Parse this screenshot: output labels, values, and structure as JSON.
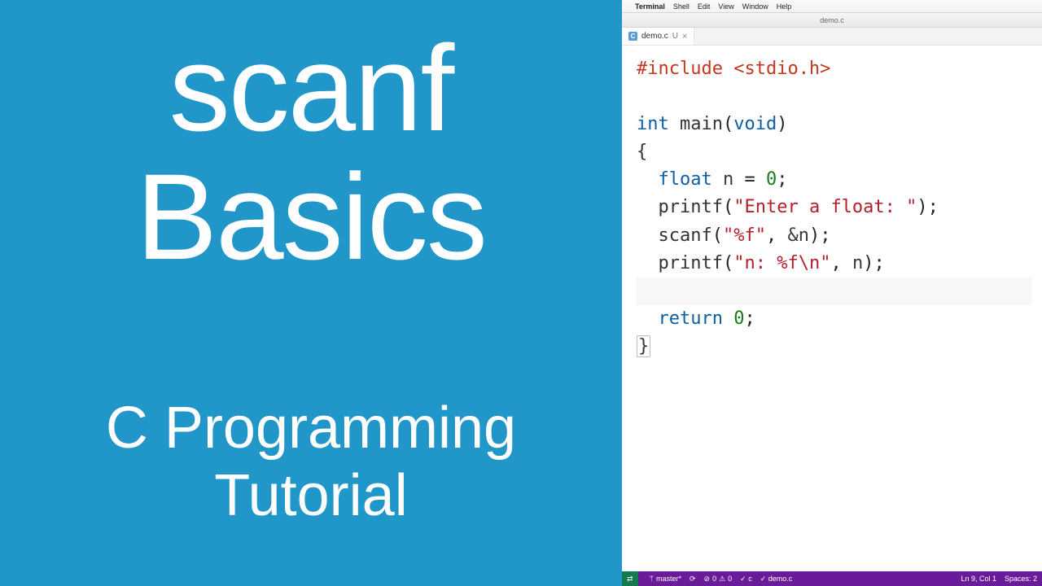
{
  "left": {
    "title_line1": "scanf",
    "title_line2": "Basics",
    "subtitle_line1": "C Programming",
    "subtitle_line2": "Tutorial"
  },
  "menubar": {
    "apple": "",
    "app": "Terminal",
    "items": [
      "Shell",
      "Edit",
      "View",
      "Window",
      "Help"
    ]
  },
  "window": {
    "title": "demo.c"
  },
  "tab": {
    "icon_letter": "C",
    "filename": "demo.c",
    "modified_indicator": "U",
    "close_glyph": "×"
  },
  "code": {
    "directive": "#include",
    "include_target": "<stdio.h>",
    "ret_type": "int",
    "main_name": "main",
    "void_kw": "void",
    "open_brace": "{",
    "float_kw": "float",
    "var_n": "n",
    "eq": "=",
    "zero": "0",
    "semi": ";",
    "printf1_name": "printf",
    "printf1_arg": "\"Enter a float: \"",
    "scanf_name": "scanf",
    "scanf_fmt": "\"%f\"",
    "amp_n": "&n",
    "printf2_name": "printf",
    "printf2_fmt": "\"n: %f\\n\"",
    "printf2_arg": "n",
    "return_kw": "return",
    "return_val": "0",
    "close_brace": "}"
  },
  "statusbar": {
    "remote_glyph": "⇄",
    "branch": "master*",
    "sync_glyph": "⟳",
    "errors": "0",
    "warnings": "0",
    "lang_check": "✓ c",
    "file_check": "✓ demo.c",
    "cursor": "Ln 9, Col 1",
    "spaces": "Spaces: 2"
  }
}
